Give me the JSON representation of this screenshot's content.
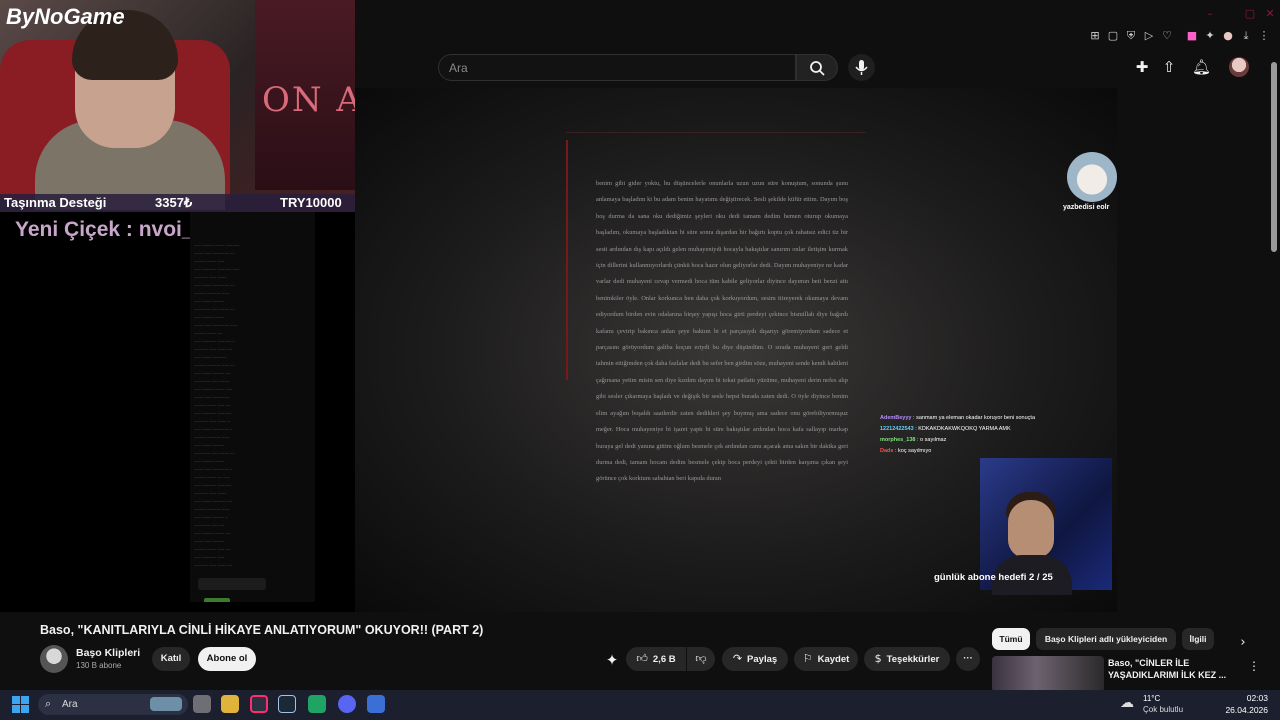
{
  "webcam": {
    "logo": "ByNoGame",
    "poster_text": "ON A",
    "info_left": "Taşınma Desteği",
    "info_mid": "3357₺",
    "info_right": "TRY10000",
    "follower_alert": "Yeni Çiçek : nvoi_mitsbrex"
  },
  "youtube_header": {
    "search_placeholder": "Ara"
  },
  "video": {
    "doc_text": "benim gibi gider yoktu, bu düşüncelerle onunlarla uzun uzun süre konuştum, sonunda şunu anlamaya başladım ki bu adam benim hayatımı değiştirecek. Sesli şekilde küfür ettim. Dayım boş boş durma da sana oku dediğimiz şeyleri oku dedi tamam dedim hemen oturup okumaya başladım, okumaya başladıktan bi süre sonra dışardan bir bağırtı koptu çok rahatsız edici tiz bir sesti ardından dış kapı açıldı gelen muhayeniydi hocayla bakıştılar sanırım onlar iletişim kurmak için dillerini kullanmıyorlardı çünkü hoca hazır olun geliyorlar dedi. Dayım muhayeniye ne kadar varlar dedi muhayeni cevap vermedi hoca tüm kabile geliyorlar diyince dayımın beti benzi attı benimkiler öyle. Onlar korkunca ben daha çok korkuyordum, sesim titreyerek okumaya devam ediyordum birden evin odalarına birşey yapışı hoca girti perdeyi çekince bismillah diye bağırdı kafamı çevirip bakınca anlan şeye baktım bi et parçasıydı dışarıyı göremiyordum sadece et parçasını görüyordum galiba koçun eriydi bu diye düşündüm. O sırada muhayeni geri geldi tahmin ettiğimden çok daha fazlalar dedi bu sefer ben girdim söze, muhayeni sende kendi kabileni çağırsana yetim misin sen diye kızdım dayım bi tokat patlattı yüzüme, muhayeni derin nefes alıp gibi sesler çıkarmaya başladı ve değişik bir sesle hepsi burada zaten dedi. O öyle diyince benim elim ayağım boşaldı saatlerdir zaten dedikleri şey buymuş ama sadece onu görebiliyormuşuz meğer. Hoca muhayeniye bi işaret yaptı bi süre bakıştılar ardından hoca kafa sallayıp markap buraya gel dedi yanına gittim oğlum besmele çek ardından camı açacak ama sakın bir dakika geri durma dedi, tamam hocam dedim besmele çekip hoca perdeyi çekti birden karşıma çıkan şeyi görünce çok korktum sabahtan beri kapıda duran",
    "cat_name": "yazbedisi eolr",
    "overlay_chat": [
      {
        "name": "AdemBeyyy",
        "text": ": sanmam ya eleman okadar koruyor beni sonuçta"
      },
      {
        "name": "12212422543",
        "text": ": KDKAKDKAKWKQOKQ YARMA AMK"
      },
      {
        "name": "morphes_138",
        "text": ": o sayılmaz"
      },
      {
        "name": "Dads",
        "text": ": koç sayılmıyo"
      }
    ],
    "cam2_caption": "günlük abone hedefi 2 / 25"
  },
  "below_video": {
    "title": "Baso, \"KANITLARIYLA CİNLİ HİKAYE ANLATIYORUM\" OKUYOR!! (PART 2)",
    "channel_name": "Başo Klipleri",
    "channel_subs": "130 B abone",
    "join_label": "Katıl",
    "subscribe_label": "Abone ol",
    "like_count": "2,6 B",
    "share_label": "Paylaş",
    "save_label": "Kaydet",
    "thanks_label": "Teşekkürler"
  },
  "recommendations": {
    "chips": [
      "Tümü",
      "Başo Klipleri adlı yükleyiciden",
      "İlgili"
    ],
    "first_title": "Baso, \"CİNLER İLE YAŞADIKLARIMI İLK KEZ ..."
  },
  "taskbar": {
    "search_label": "Ara",
    "weather_temp": "11°C",
    "weather_desc": "Çok bulutlu",
    "time": "02:03",
    "date": "26.04.2026"
  }
}
